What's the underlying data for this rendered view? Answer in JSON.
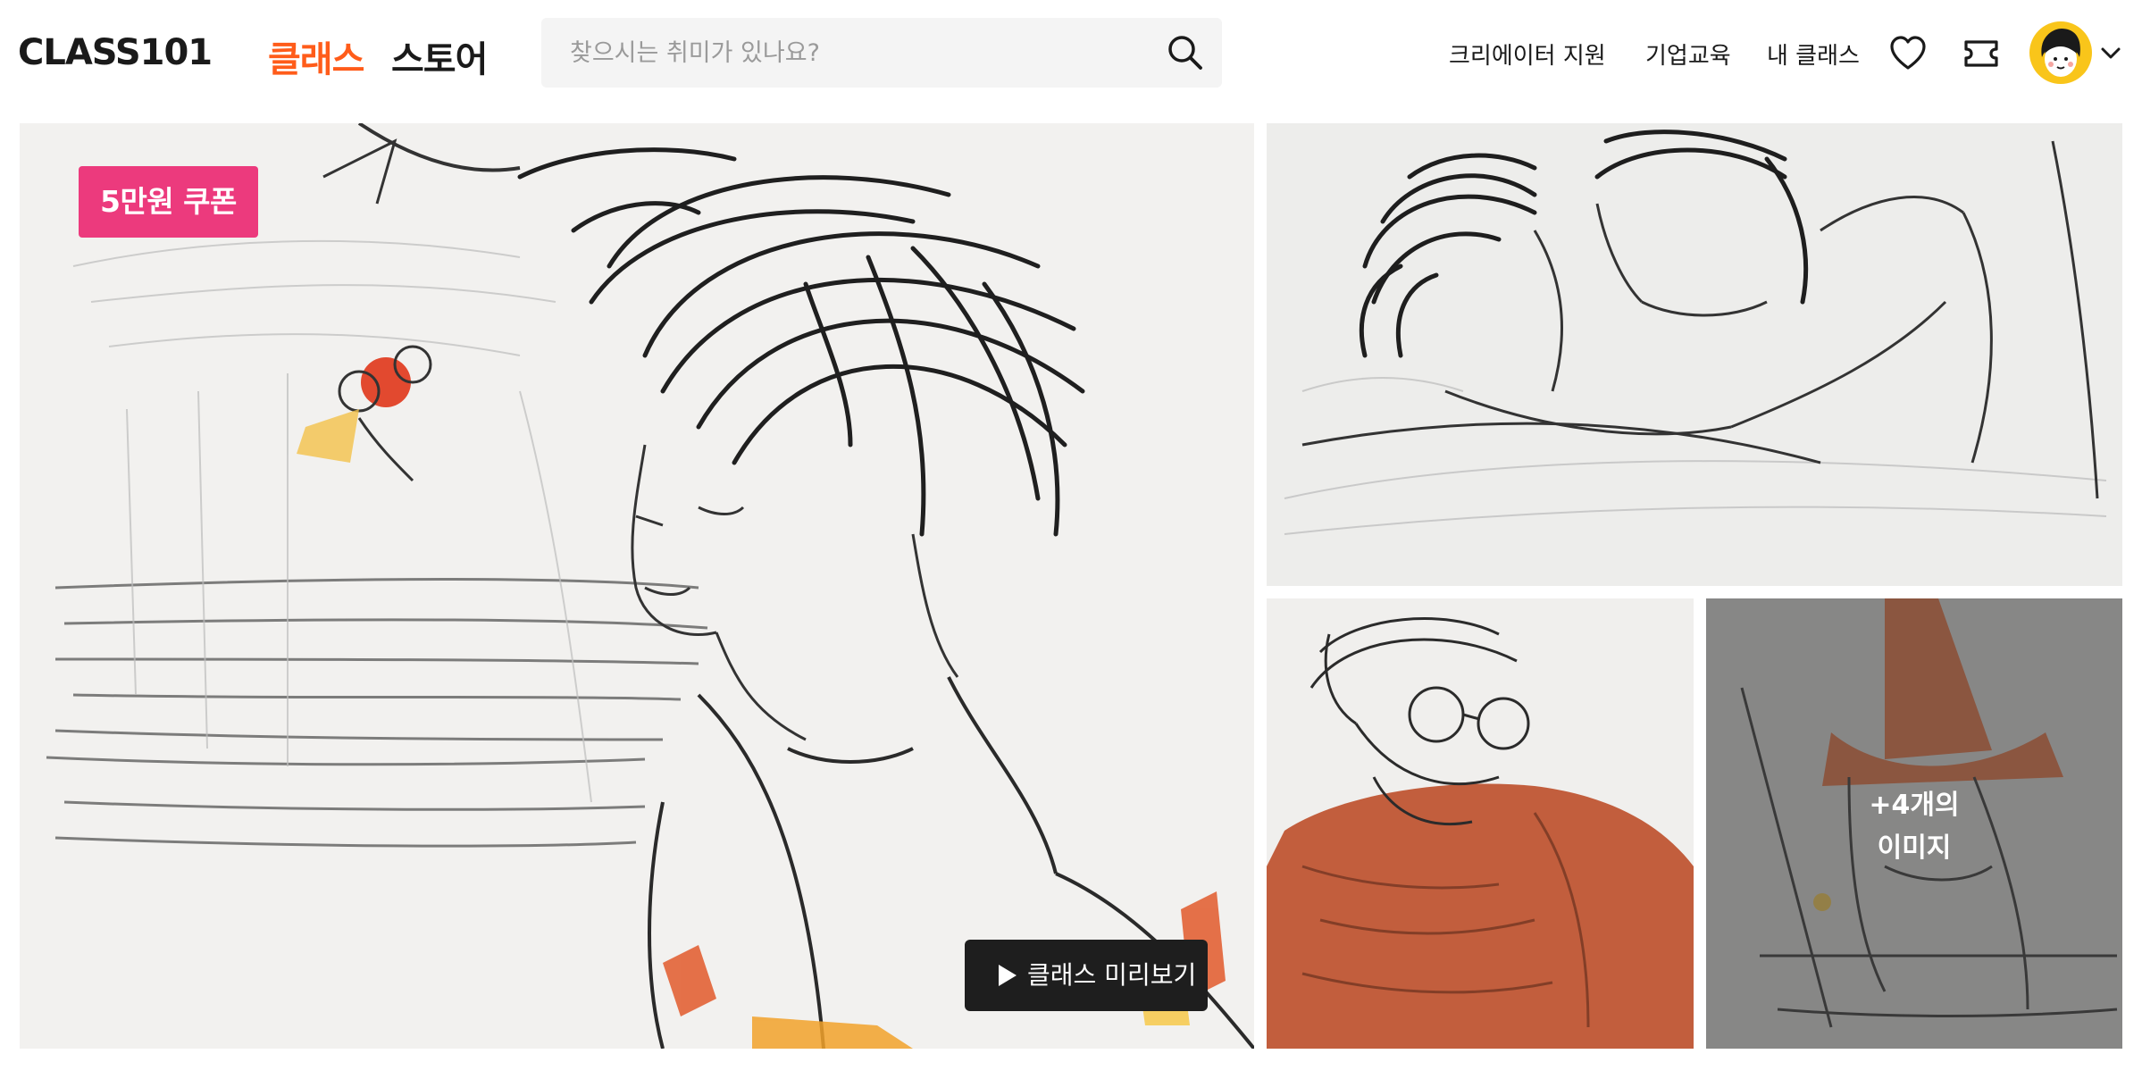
{
  "header": {
    "logo": "CLASS101",
    "tabs": [
      {
        "label": "클래스",
        "active": true
      },
      {
        "label": "스토어",
        "active": false
      }
    ],
    "search": {
      "placeholder": "찾으시는 취미가 있나요?",
      "value": ""
    },
    "links": [
      "크리에이터 지원",
      "기업교육",
      "내 클래스"
    ],
    "icons": [
      "heart-icon",
      "ticket-icon",
      "avatar",
      "chevron-down-icon"
    ]
  },
  "gallery": {
    "coupon_badge": "5만원 쿠폰",
    "preview_button": "클래스 미리보기",
    "more_images": {
      "line1": "+4개의",
      "line2": "이미지"
    }
  },
  "colors": {
    "accent": "#ff5c1a",
    "coupon": "#ec3a7d",
    "dark_button": "#1e1e1e",
    "search_bg": "#f4f4f4",
    "avatar_bg": "#f9c51a"
  }
}
